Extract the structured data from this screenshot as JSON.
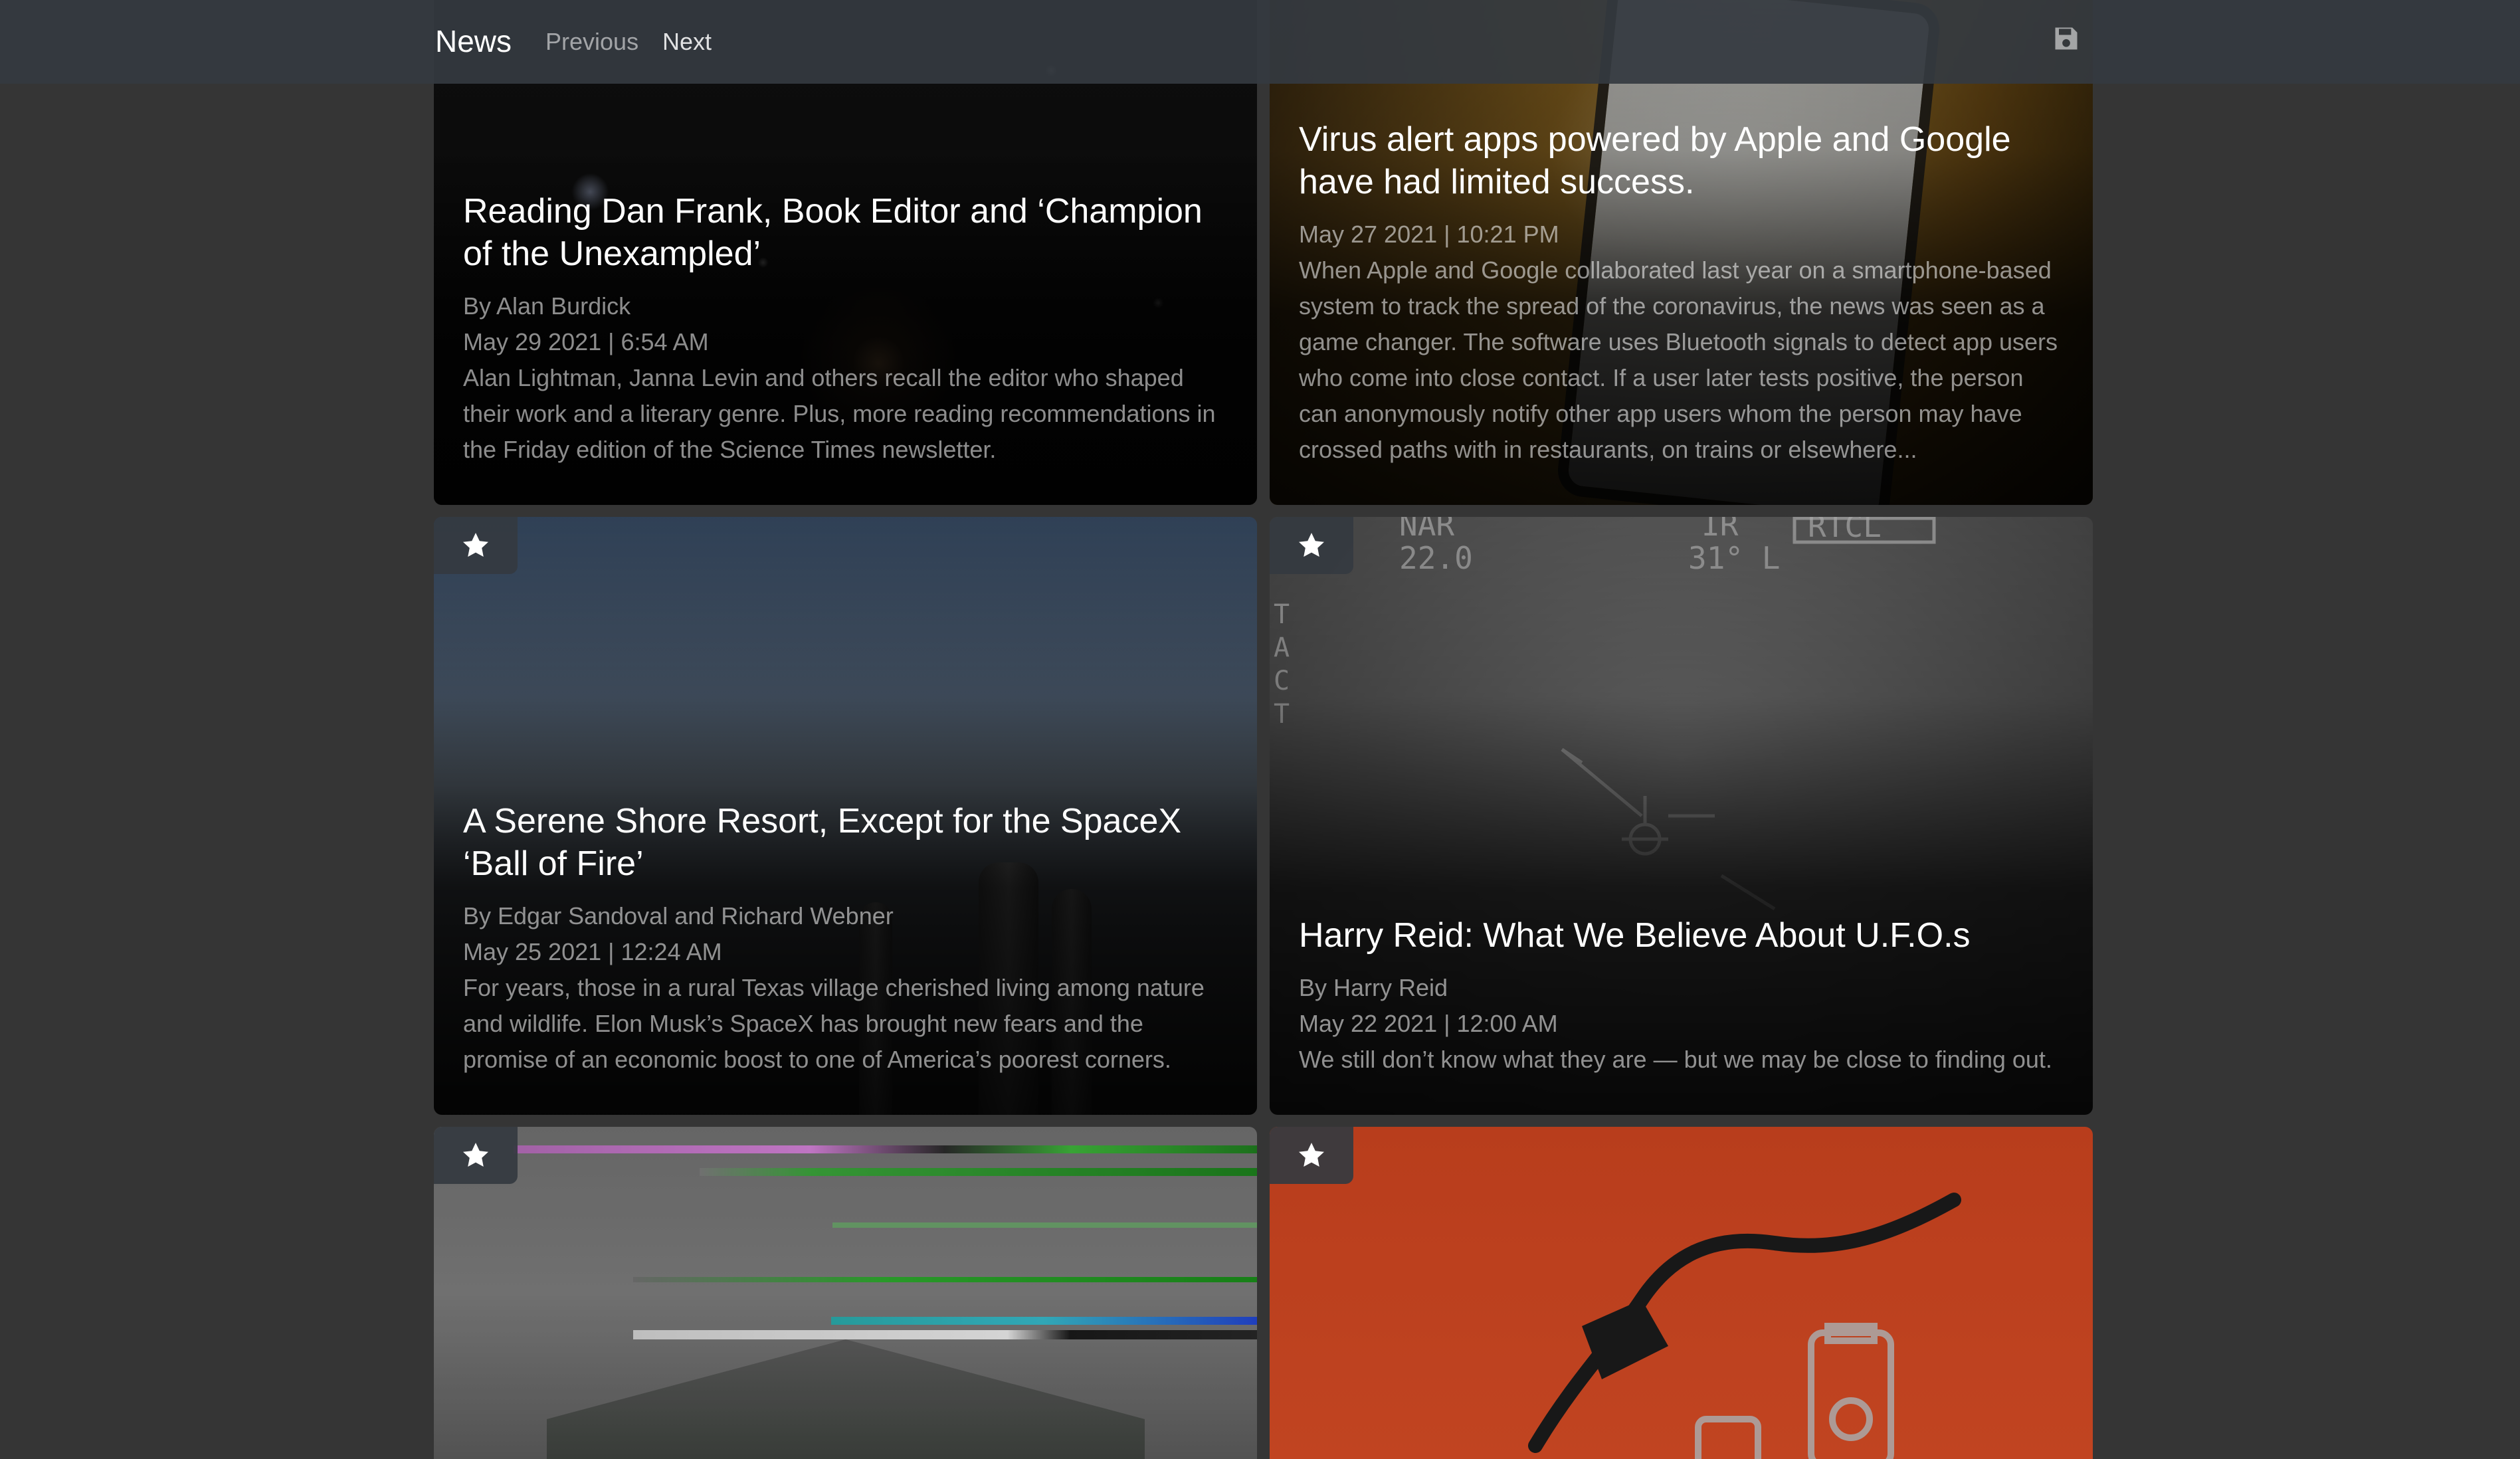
{
  "navbar": {
    "brand": "News",
    "previous": "Previous",
    "next": "Next",
    "save_icon": "save-icon"
  },
  "articles": [
    {
      "title": "Reading Dan Frank, Book Editor and ‘Champion of the Unexampled’",
      "byline": "By Alan Burdick",
      "date": "May 29 2021 | 6:54 AM",
      "summary": "Alan Lightman, Janna Levin and others recall the editor who shaped their work and a literary genre. Plus, more reading recommendations in the Friday edition of the Science Times newsletter."
    },
    {
      "title": "Virus alert apps powered by Apple and Google have had limited success.",
      "byline": "",
      "date": "May 27 2021 | 10:21 PM",
      "summary": "When Apple and Google collaborated last year on a smartphone-based system to track the spread of the coronavirus, the news was seen as a game changer. The software uses Bluetooth signals to detect app users who come into close contact. If a user later tests positive, the person can anonymously notify other app users whom the person may have crossed paths with in restaurants, on trains or elsewhere..."
    },
    {
      "title": "A Serene Shore Resort, Except for the SpaceX ‘Ball of Fire’",
      "byline": "By Edgar Sandoval and Richard Webner",
      "date": "May 25 2021 | 12:24 AM",
      "summary": "For years, those in a rural Texas village cherished living among nature and wildlife. Elon Musk’s SpaceX has brought new fears and the promise of an economic boost to one of America’s poorest corners."
    },
    {
      "title": "Harry Reid: What We Believe About U.F.O.s",
      "byline": "By Harry Reid",
      "date": "May 22 2021 | 12:00 AM",
      "summary": "We still don’t know what they are — but we may be close to finding out."
    },
    {
      "title": "",
      "byline": "",
      "date": "",
      "summary": ""
    },
    {
      "title": "",
      "byline": "",
      "date": "",
      "summary": ""
    }
  ],
  "ufo_overlay": {
    "top_left": "NAR\n22.0",
    "top_center": "IR\n31° L",
    "top_right": "RTCL",
    "side": "TACT"
  },
  "icons": {
    "favorite": "star-icon",
    "save": "save-icon"
  },
  "colors": {
    "navbar": "#343a40",
    "background": "#353535",
    "text_primary": "#ffffff",
    "text_muted": "#8c8c8c"
  }
}
